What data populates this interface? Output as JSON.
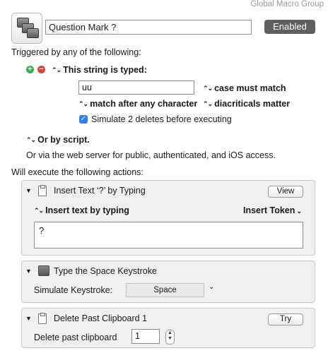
{
  "group_name": "Global Macro Group",
  "macro": {
    "name": "Question Mark ?",
    "enabled_label": "Enabled"
  },
  "triggers": {
    "heading": "Triggered by any of the following:",
    "string_trigger": {
      "label": "This string is typed:",
      "value": "uu",
      "case_option": "case must match",
      "match_option": "match after any character",
      "diacritics_option": "diacriticals matter",
      "simulate_deletes_label": "Simulate 2 deletes before executing",
      "simulate_deletes_checked": true
    },
    "or_by_script": "Or by script.",
    "web_server_note": "Or via the web server for public, authenticated, and iOS access."
  },
  "actions": {
    "heading": "Will execute the following actions:",
    "insert_text": {
      "title": "Insert Text ‘?’ by Typing",
      "view_button": "View",
      "mode": "Insert text by typing",
      "insert_token": "Insert Token",
      "text": "?"
    },
    "type_keystroke": {
      "title": "Type the Space Keystroke",
      "label": "Simulate Keystroke:",
      "key": "Space"
    },
    "delete_clipboard": {
      "title": "Delete Past Clipboard 1",
      "try_button": "Try",
      "label": "Delete past clipboard",
      "value": "1"
    }
  },
  "colors": {
    "add_green": "#2db34a",
    "remove_red": "#e0413a",
    "check_blue": "#2f7df6",
    "enabled_bg": "#5f5f5f"
  }
}
